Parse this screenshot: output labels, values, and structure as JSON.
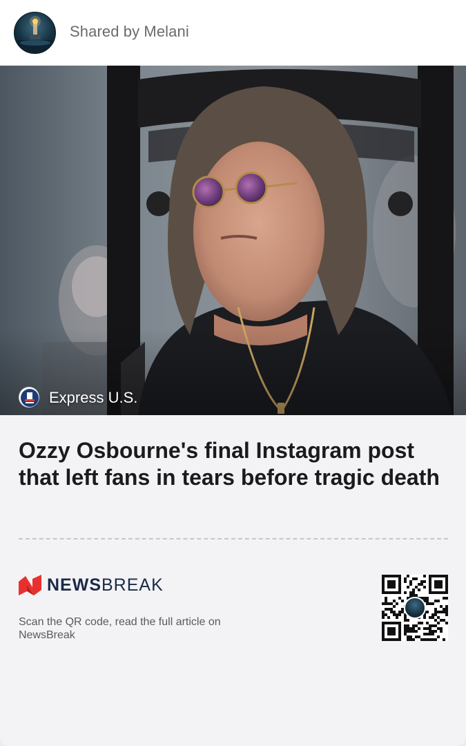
{
  "header": {
    "shared_by": "Shared by Melani",
    "avatar_icon": "lighthouse-avatar-icon"
  },
  "article": {
    "source_name": "Express U.S.",
    "source_icon": "express-us-logo-icon",
    "headline": "Ozzy Osbourne's final Instagram post that left fans in tears before tragic death"
  },
  "footer": {
    "brand_bold": "NEWS",
    "brand_light": "BREAK",
    "brand_icon": "newsbreak-logo-icon",
    "scan_text": "Scan the QR code, read the full article on NewsBreak",
    "qr_icon": "qr-code-icon"
  },
  "colors": {
    "brand_red": "#e8312f",
    "brand_navy": "#1b2a48",
    "headline": "#1b1b1d",
    "card_bg": "#f3f3f5"
  }
}
